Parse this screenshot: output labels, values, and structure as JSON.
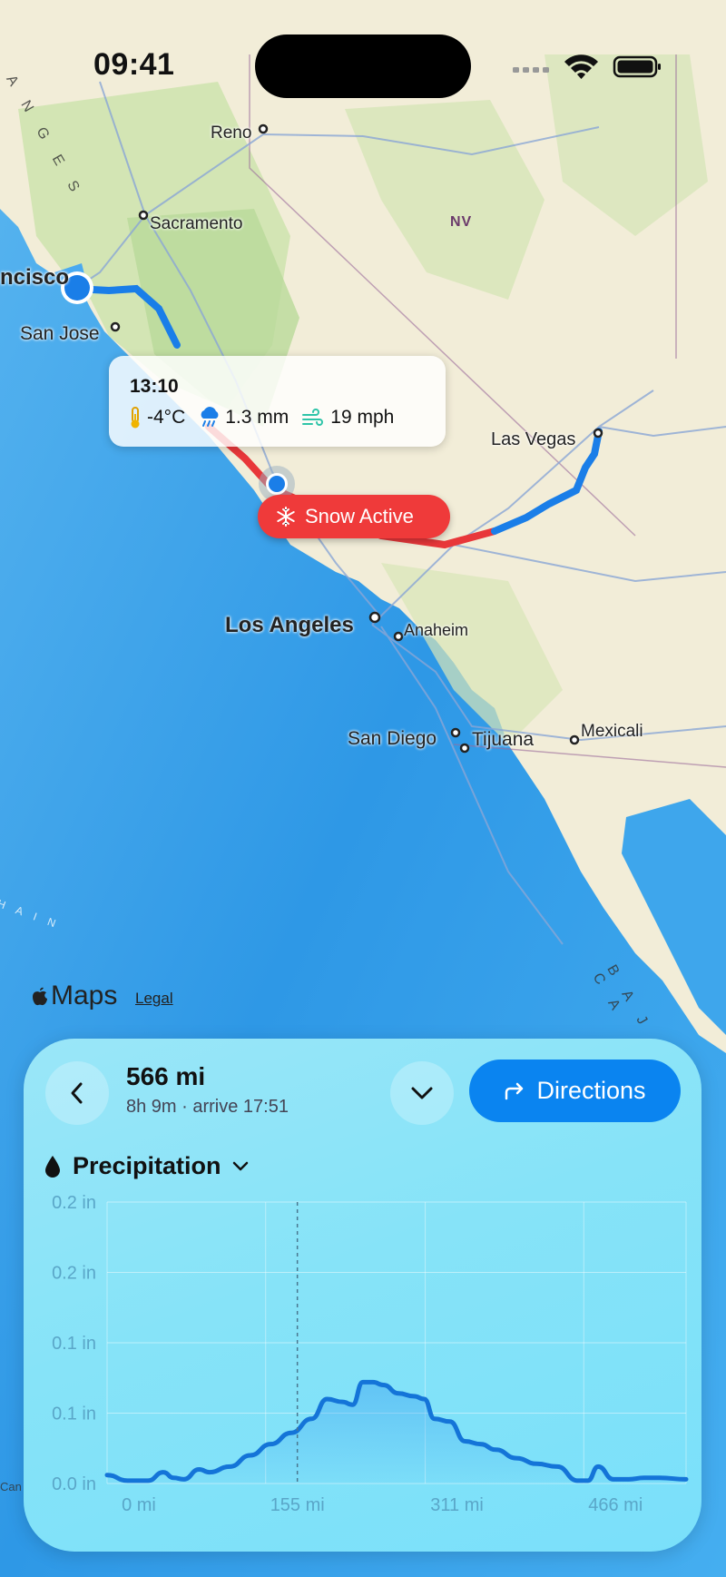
{
  "status_bar": {
    "time": "09:41"
  },
  "map": {
    "labels": {
      "reno": "Reno",
      "sacramento": "Sacramento",
      "san_francisco": "ncisco",
      "san_jose": "San Jose",
      "nv": "NV",
      "las_vegas": "Las Vegas",
      "los_angeles": "Los Angeles",
      "anaheim": "Anaheim",
      "san_diego": "San Diego",
      "tijuana": "Tijuana",
      "mexicali": "Mexicali",
      "ranges": "A N G E S",
      "baja": "B A J A   C A",
      "chain": "H A I N",
      "can": "Can"
    },
    "attribution": {
      "logo": "Maps",
      "legal": "Legal"
    }
  },
  "callout": {
    "time": "13:10",
    "temperature": "-4°C",
    "precipitation": "1.3 mm",
    "wind": "19 mph"
  },
  "alert": {
    "label": "Snow Active",
    "color": "#ef3a3a"
  },
  "sheet": {
    "distance": "566 mi",
    "subtitle": "8h 9m · arrive 17:51",
    "directions_label": "Directions",
    "metric_label": "Precipitation"
  },
  "chart_data": {
    "type": "area",
    "y_tick_labels": [
      "0.2 in",
      "0.2 in",
      "0.1 in",
      "0.1 in",
      "0.0 in"
    ],
    "x_tick_labels": [
      "0 mi",
      "155 mi",
      "311 mi",
      "466 mi"
    ],
    "ylim": [
      0,
      0.2
    ],
    "xlim": [
      0,
      566
    ],
    "grid": true,
    "x": [
      0,
      20,
      40,
      55,
      65,
      75,
      90,
      100,
      120,
      140,
      160,
      180,
      200,
      215,
      230,
      240,
      250,
      260,
      270,
      285,
      300,
      310,
      320,
      335,
      350,
      365,
      380,
      400,
      420,
      440,
      460,
      470,
      480,
      495,
      510,
      525,
      540,
      566
    ],
    "values": [
      0.006,
      0.002,
      0.002,
      0.008,
      0.004,
      0.003,
      0.01,
      0.008,
      0.012,
      0.02,
      0.028,
      0.036,
      0.046,
      0.06,
      0.058,
      0.056,
      0.072,
      0.072,
      0.07,
      0.064,
      0.062,
      0.06,
      0.046,
      0.044,
      0.03,
      0.028,
      0.024,
      0.018,
      0.014,
      0.012,
      0.002,
      0.002,
      0.012,
      0.003,
      0.003,
      0.004,
      0.004,
      0.003
    ],
    "cursor_x": 186,
    "line_color": "#1474d8"
  }
}
